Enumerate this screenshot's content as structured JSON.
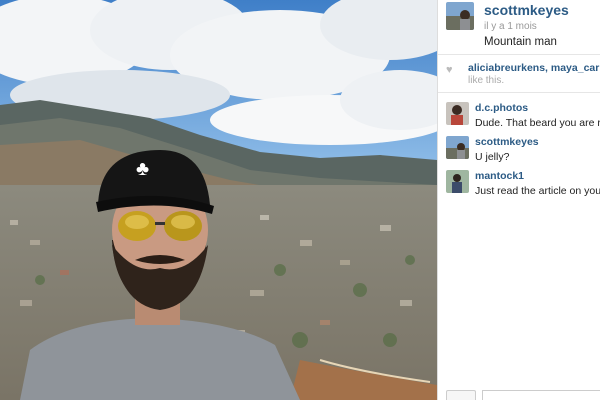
{
  "post": {
    "username": "scottmkeyes",
    "timestamp": "il y a 1 mois",
    "caption": "Mountain man"
  },
  "likes": {
    "usernames": "aliciabreurkens, maya_carpedi",
    "suffix": "like this."
  },
  "comments": [
    {
      "username": "d.c.photos",
      "text": "Dude. That beard you are roc"
    },
    {
      "username": "scottmkeyes",
      "text": "U jelly?"
    },
    {
      "username": "mantock1",
      "text": "Just read the article on you ,"
    }
  ],
  "icons": {
    "heart": "heart-icon"
  },
  "colors": {
    "username": "#2c5b85",
    "sky": "#4f8fd0",
    "panel_bg": "#ffffff"
  }
}
